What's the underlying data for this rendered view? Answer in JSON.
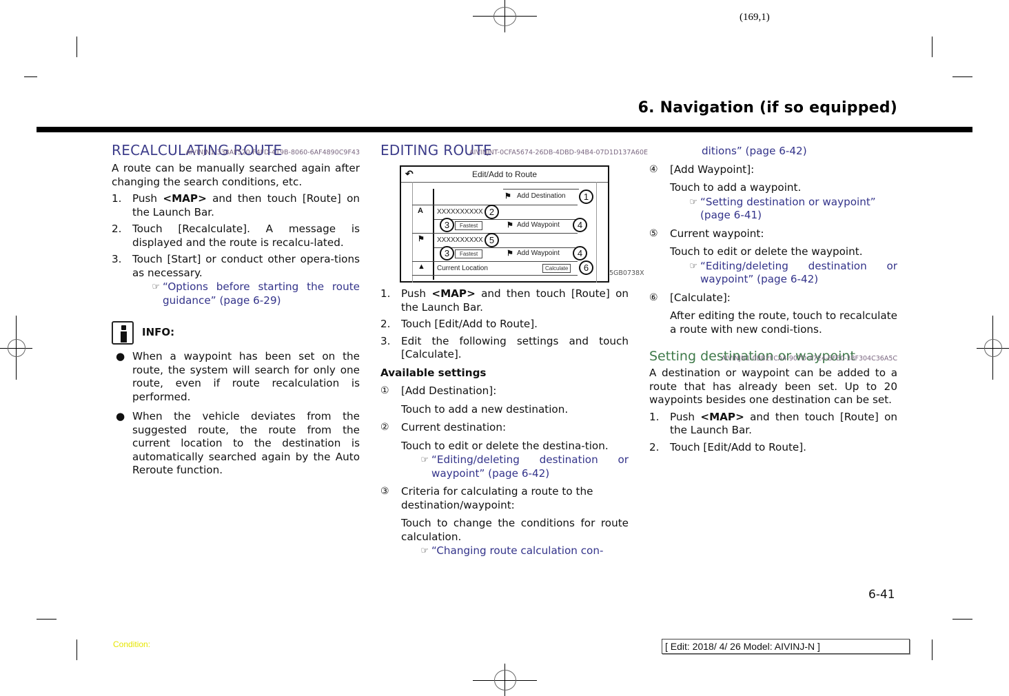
{
  "header": {
    "page_code": "(169,1)",
    "chapter_title": "6. Navigation (if so equipped)"
  },
  "col1": {
    "heading": "RECALCULATING ROUTE",
    "heading_id": "AIVINJN1-338AF520-F4FD-419B-8060-6AF4890C9F43",
    "intro": "A route can be manually searched again after changing the search conditions, etc.",
    "steps": [
      {
        "num": "1.",
        "pre": "Push ",
        "bold": "<MAP>",
        "post": " and then touch [Route] on the Launch Bar."
      },
      {
        "num": "2.",
        "pre": "Touch [Recalculate]. A message is displayed and the route is recalcu-lated.",
        "bold": "",
        "post": ""
      },
      {
        "num": "3.",
        "pre": "Touch [Start] or conduct other opera-tions as necessary.",
        "bold": "",
        "post": ""
      }
    ],
    "ref": "“Options before starting the route guidance” (page 6-29)",
    "info_label": "INFO:",
    "bullets": [
      "When a waypoint has been set on the route, the system will search for only one route, even if route recalculation is performed.",
      "When the vehicle deviates from the suggested route, the route from the current location to the destination is automatically searched again by the Auto Reroute function."
    ]
  },
  "col2": {
    "heading": "EDITING ROUTE",
    "heading_id": "AIVINJNT-0CFA5674-26DB-4DBD-94B4-07D1D137A60E",
    "figure": {
      "title": "Edit/Add to Route",
      "add_destination": "Add Destination",
      "destination": "XXXXXXXXXX",
      "fastest_1": "Fastest",
      "add_waypoint_1": "Add Waypoint",
      "waypoint": "XXXXXXXXXX",
      "fastest_2": "Fastest",
      "add_waypoint_2": "Add Waypoint",
      "current_location": "Current Location",
      "calculate": "Calculate",
      "callouts": [
        "1",
        "2",
        "3",
        "4",
        "5",
        "3",
        "4",
        "6"
      ],
      "code": "5GB0738X"
    },
    "steps": [
      {
        "num": "1.",
        "pre": "Push ",
        "bold": "<MAP>",
        "post": " and then touch [Route] on the Launch Bar."
      },
      {
        "num": "2.",
        "pre": "Touch [Edit/Add to Route].",
        "bold": "",
        "post": ""
      },
      {
        "num": "3.",
        "pre": "Edit the following settings and touch [Calculate].",
        "bold": "",
        "post": ""
      }
    ],
    "available_settings": "Available settings",
    "items": [
      {
        "circ": "①",
        "label": "[Add Destination]:",
        "desc": "Touch to add a new destination.",
        "ref": ""
      },
      {
        "circ": "②",
        "label": "Current destination:",
        "desc": "Touch to edit or delete the destina-tion.",
        "ref": "“Editing/deleting destination or waypoint” (page 6-42)"
      },
      {
        "circ": "③",
        "label": "Criteria for calculating a route to the destination/waypoint:",
        "desc": "Touch to change the conditions for route calculation.",
        "ref": "“Changing route calculation con-"
      }
    ]
  },
  "col3": {
    "ref_continued": "ditions” (page 6-42)",
    "items": [
      {
        "circ": "④",
        "label": "[Add Waypoint]:",
        "desc": "Touch to add a waypoint.",
        "ref": "“Setting destination or waypoint” (page 6-41)"
      },
      {
        "circ": "⑤",
        "label": "Current waypoint:",
        "desc": "Touch to edit or delete the waypoint.",
        "ref": "“Editing/deleting destination or waypoint” (page 6-42)"
      },
      {
        "circ": "⑥",
        "label": "[Calculate]:",
        "desc": "After editing the route, touch to recalculate a route with new condi-tions.",
        "ref": ""
      }
    ],
    "subheading": "Setting destination or waypoint",
    "subheading_id": "AIVINJN1-0BB2FCA4-907D-47E4-BFE0-38F304C36A5C",
    "intro": "A destination or waypoint can be added to a route that has already been set. Up to 20 waypoints besides one destination can be set.",
    "steps": [
      {
        "num": "1.",
        "pre": "Push ",
        "bold": "<MAP>",
        "post": " and then touch [Route] on the Launch Bar."
      },
      {
        "num": "2.",
        "pre": "Touch [Edit/Add to Route].",
        "bold": "",
        "post": ""
      }
    ]
  },
  "footer": {
    "page_number": "6-41",
    "condition": "Condition:",
    "edit_info": "[ Edit: 2018/ 4/ 26   Model:  AIVINJ-N ]"
  },
  "icons": {
    "ref_icon": "☞"
  },
  "colors": {
    "heading": "#3d3d8a",
    "subheading": "#3f7a4a",
    "link": "#33338a",
    "condition": "#e6e600"
  }
}
